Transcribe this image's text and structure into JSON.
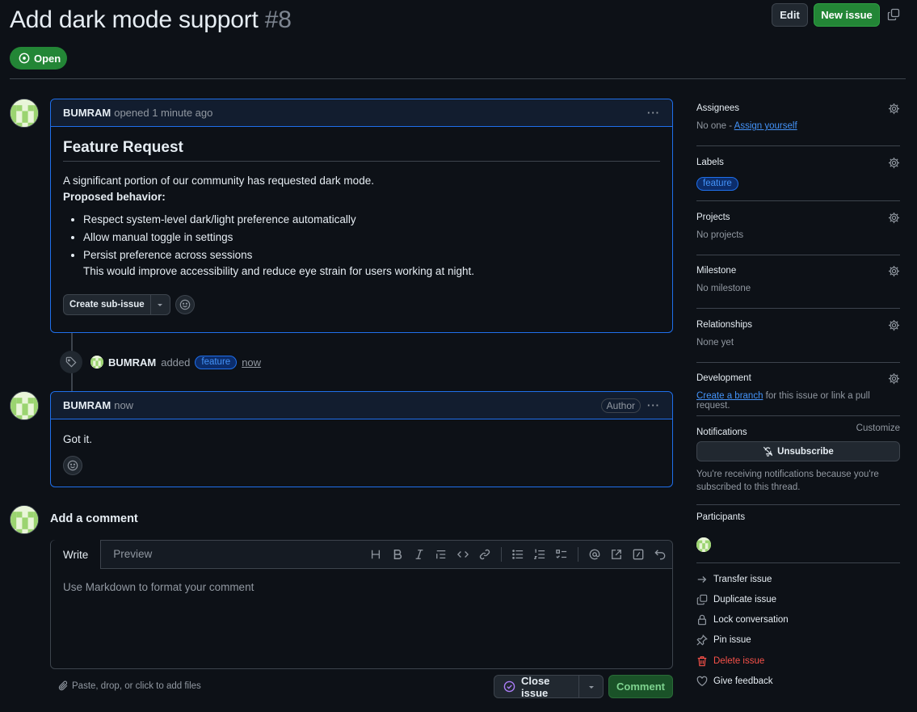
{
  "header": {
    "title": "Add dark mode support",
    "number": "#8",
    "edit_label": "Edit",
    "new_issue_label": "New issue",
    "state": "Open"
  },
  "issue_comment": {
    "author": "BUMRAM",
    "meta": "opened 1 minute ago",
    "heading": "Feature Request",
    "intro": "A significant portion of our community has requested dark mode.",
    "proposed_label": "Proposed behavior:",
    "bullets": [
      "Respect system-level dark/light preference automatically",
      "Allow manual toggle in settings",
      "Persist preference across sessions"
    ],
    "closing": "This would improve accessibility and reduce eye strain for users working at night.",
    "sub_issue_label": "Create sub-issue"
  },
  "event": {
    "author": "BUMRAM",
    "action": "added",
    "label": "feature",
    "time": "now"
  },
  "reply_comment": {
    "author": "BUMRAM",
    "time": "now",
    "badge": "Author",
    "body": "Got it."
  },
  "composer": {
    "title": "Add a comment",
    "tab_write": "Write",
    "tab_preview": "Preview",
    "placeholder": "Use Markdown to format your comment",
    "attach_hint": "Paste, drop, or click to add files",
    "close_label": "Close issue",
    "comment_label": "Comment"
  },
  "sidebar": {
    "assignees": {
      "title": "Assignees",
      "value": "No one - ",
      "link": "Assign yourself"
    },
    "labels": {
      "title": "Labels",
      "label": "feature"
    },
    "projects": {
      "title": "Projects",
      "value": "No projects"
    },
    "milestone": {
      "title": "Milestone",
      "value": "No milestone"
    },
    "relationships": {
      "title": "Relationships",
      "value": "None yet"
    },
    "development": {
      "title": "Development",
      "link": "Create a branch",
      "value": " for this issue or link a pull request."
    },
    "notifications": {
      "title": "Notifications",
      "customize": "Customize",
      "button": "Unsubscribe",
      "note_line1": "You're receiving notifications because you're",
      "note_line2": "subscribed to this thread."
    },
    "participants": {
      "title": "Participants"
    },
    "actions": {
      "transfer": "Transfer issue",
      "duplicate": "Duplicate issue",
      "lock": "Lock conversation",
      "pin": "Pin issue",
      "delete": "Delete issue",
      "feedback": "Give feedback"
    }
  },
  "colors": {
    "background": "#0d1117",
    "accent_green": "#238636",
    "accent_blue": "#1f6feb",
    "danger": "#f85149"
  }
}
